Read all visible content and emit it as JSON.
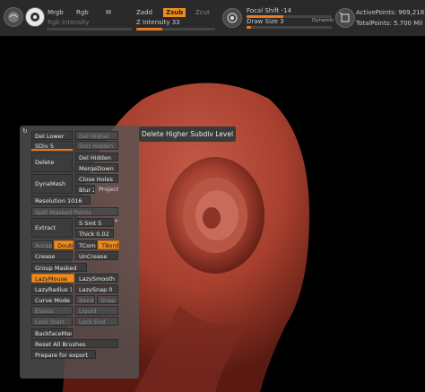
{
  "topbar": {
    "mrgb": "Mrgb",
    "rgb": "Rgb",
    "m": "M",
    "zadd": "Zadd",
    "zsub": "Zsub",
    "zcut": "Zcut",
    "rgb_intensity": "Rgb Intensity",
    "z_intensity": "Z Intensity 33",
    "focal_shift": "Focal Shift -14",
    "draw_size": "Draw Size 3",
    "dynamic": "Dynamic",
    "active_points": "ActivePoints: 969,218",
    "total_points": "TotalPoints: 5.700 Mil",
    "z_intensity_level": 0.33,
    "focal_shift_level": 0.43,
    "draw_size_level": 0.05
  },
  "tooltip": "Delete Higher Subdiv Level",
  "panel": {
    "del_lower": "Del Lower",
    "del_higher": "Del Higher",
    "sdiv": "SDiv 5",
    "sdiv_level": 1,
    "smt_hidden": "Smt Hidden",
    "delete": "Delete",
    "del_hidden": "Del Hidden",
    "merge_down": "MergeDown",
    "dynamesh": "DynaMesh",
    "close_holes": "Close Holes",
    "blur": "Blur 2",
    "project": "Project",
    "resolution": "Resolution 1016",
    "split_masked": "Split Masked Points",
    "extract": "Extract",
    "s_smt": "S Smt 5",
    "thick": "Thick 0.02",
    "accept": "Accept",
    "double": "Double",
    "tcorne": "TCorne",
    "tborder": "TBorde",
    "crease": "Crease",
    "uncrease": "UnCrease",
    "group_masked": "Group Masked",
    "lazymouse": "LazyMouse",
    "lazysmooth": "LazySmooth 1",
    "lazyradius": "LazyRadius 1",
    "lazysnap": "LazySnap 0",
    "curve_mode": "Curve Mode",
    "bend": "Bend",
    "snap": "Snap",
    "elastic": "Elastic",
    "liquid": "Liquid",
    "lock_start": "Lock Start",
    "lock_end": "Lock End",
    "backface_mask": "BackfaceMask",
    "reset_brushes": "Reset All Brushes",
    "prepare_export": "Prepare for export"
  },
  "colors": {
    "accent": "#f08c1e",
    "skin": "#b04a3a",
    "panel": "#555555"
  }
}
